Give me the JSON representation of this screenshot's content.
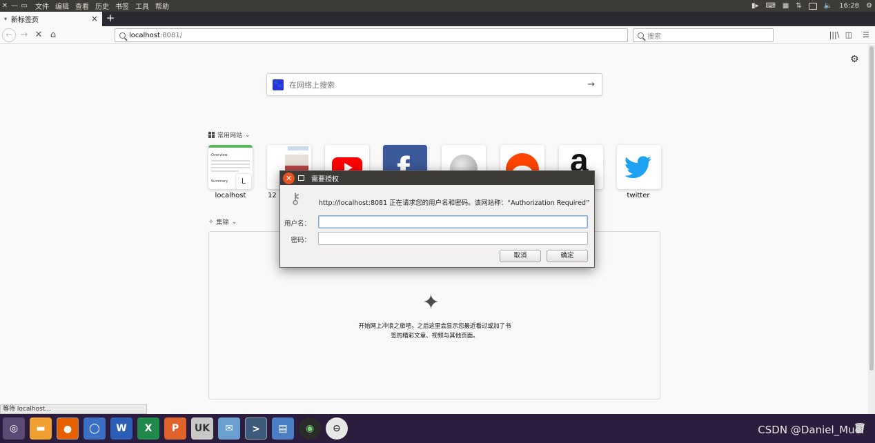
{
  "top_panel": {
    "menu": [
      "文件",
      "编辑",
      "查看",
      "历史",
      "书签",
      "工具",
      "帮助"
    ],
    "clock": "16:28"
  },
  "tab": {
    "title": "新标签页"
  },
  "navbar": {
    "url_host": "localhost",
    "url_port": ":8081/",
    "search_placeholder": "搜索"
  },
  "newtab": {
    "search_placeholder": "在网络上搜索",
    "top_sites_label": "常用网站",
    "highlights_label": "集锦",
    "tiles": [
      {
        "label": "localhost"
      },
      {
        "label": "12"
      },
      {
        "label": ""
      },
      {
        "label": ""
      },
      {
        "label": ""
      },
      {
        "label": ""
      },
      {
        "label": ""
      },
      {
        "label": "twitter"
      }
    ],
    "localhost_tile_letter": "L",
    "empty_line1": "开始网上冲浪之旅吧，之后这里会显示您最近看过或加了书",
    "empty_line2": "签的精彩文章、视频与其他页面。"
  },
  "status_text": "等待 localhost...",
  "dialog": {
    "title": "需要授权",
    "message": "http://localhost:8081 正在请求您的用户名和密码。该网站称：“Authorization Required”",
    "username_label": "用户名：",
    "password_label": "密码：",
    "cancel_label": "取消",
    "ok_label": "确定"
  },
  "watermark": "CSDN @Daniel_Muei",
  "colors": {
    "ubuntu_orange": "#e95420",
    "panel": "#3c3b37",
    "dock": "#2c1d3e"
  }
}
